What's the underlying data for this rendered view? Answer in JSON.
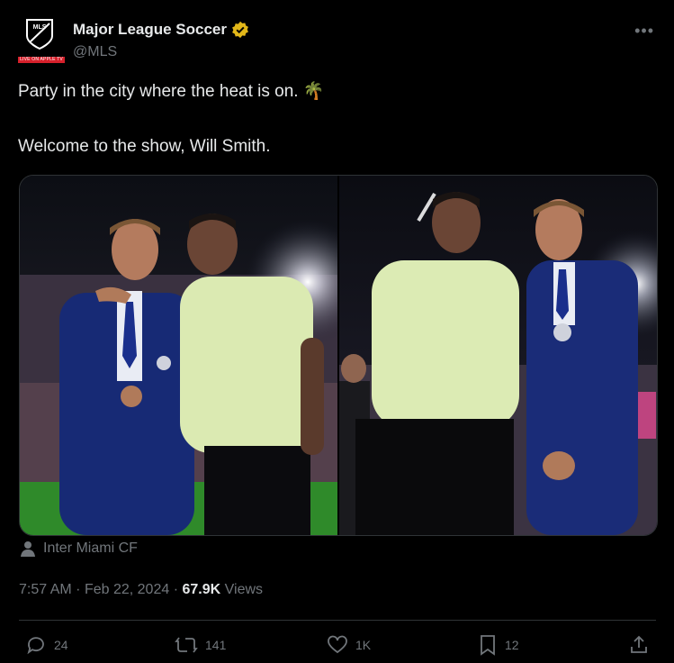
{
  "account": {
    "name": "Major League Soccer",
    "handle": "@MLS",
    "avatar_badge_text": "LIVE ON APPLE TV",
    "crest_text": "MLS"
  },
  "tweet": {
    "line1": "Party in the city where the heat is on.",
    "line2": "Welcome to the show, Will Smith.",
    "emoji": "🌴"
  },
  "location": "Inter Miami CF",
  "meta": {
    "time": "7:57 AM",
    "sep1": "·",
    "date": "Feb 22, 2024",
    "sep2": "·",
    "views_count": "67.9K",
    "views_label": "Views"
  },
  "actions": {
    "replies": "24",
    "reposts": "141",
    "likes": "1K",
    "bookmarks": "12"
  },
  "icons": {
    "more": "more-icon",
    "verified": "verified-badge-icon",
    "location": "person-icon",
    "reply": "reply-icon",
    "repost": "repost-icon",
    "like": "heart-icon",
    "bookmark": "bookmark-icon",
    "share": "share-icon"
  },
  "colors": {
    "background": "#000000",
    "text": "#e7e9ea",
    "muted": "#71767b",
    "verified_gold": "#e2b719",
    "border": "#2f3336",
    "badge_red": "#d6202b"
  }
}
